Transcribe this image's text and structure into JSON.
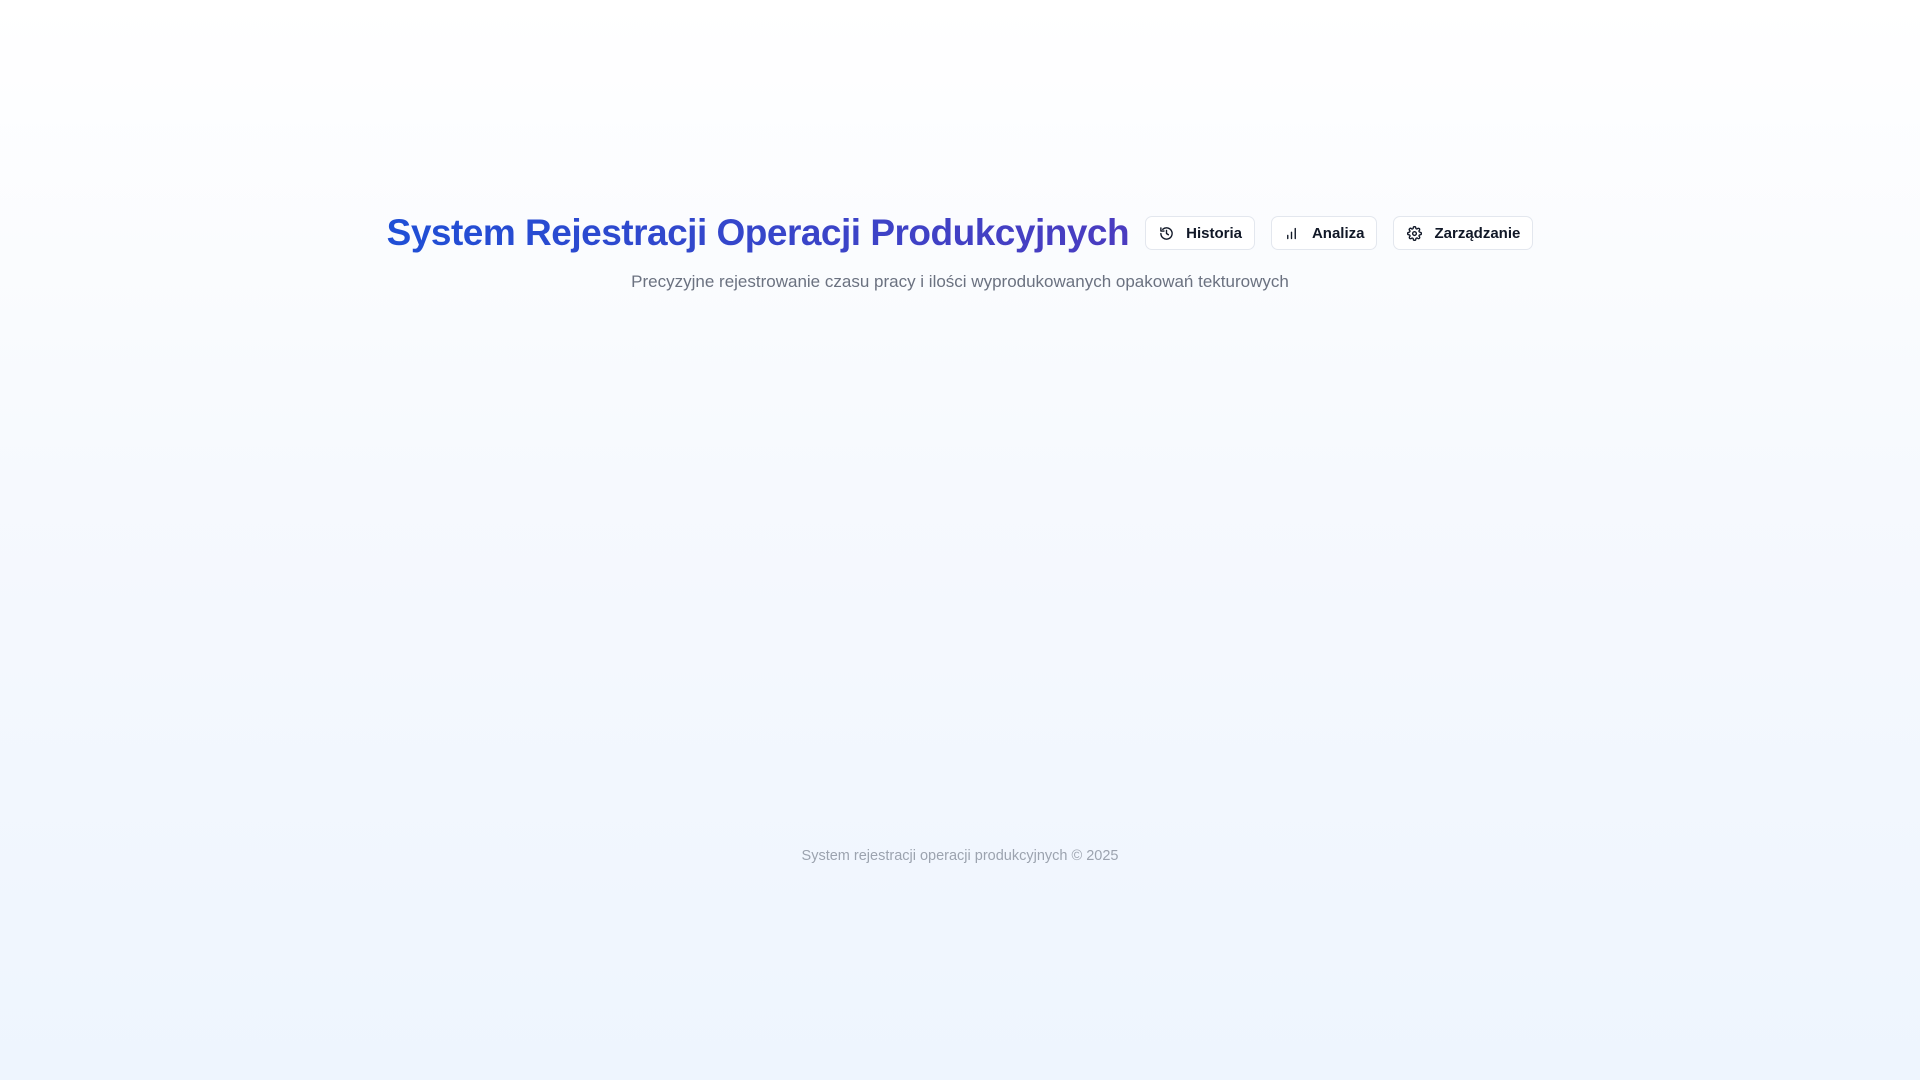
{
  "header": {
    "title": "System Rejestracji Operacji Produkcyjnych",
    "subtitle": "Precyzyjne rejestrowanie czasu pracy i ilości wyprodukowanych opakowań tekturowych"
  },
  "nav": [
    {
      "label": "Historia",
      "icon": "history-icon"
    },
    {
      "label": "Analiza",
      "icon": "bar-chart-icon"
    },
    {
      "label": "Zarządzanie",
      "icon": "gear-icon"
    }
  ],
  "footer": {
    "text": "System rejestracji operacji produkcyjnych © 2025"
  },
  "colors": {
    "title_gradient_start": "#1f4fd6",
    "title_gradient_end": "#4a3cc0",
    "subtitle": "#6b7280",
    "footer": "#9ca3af"
  }
}
